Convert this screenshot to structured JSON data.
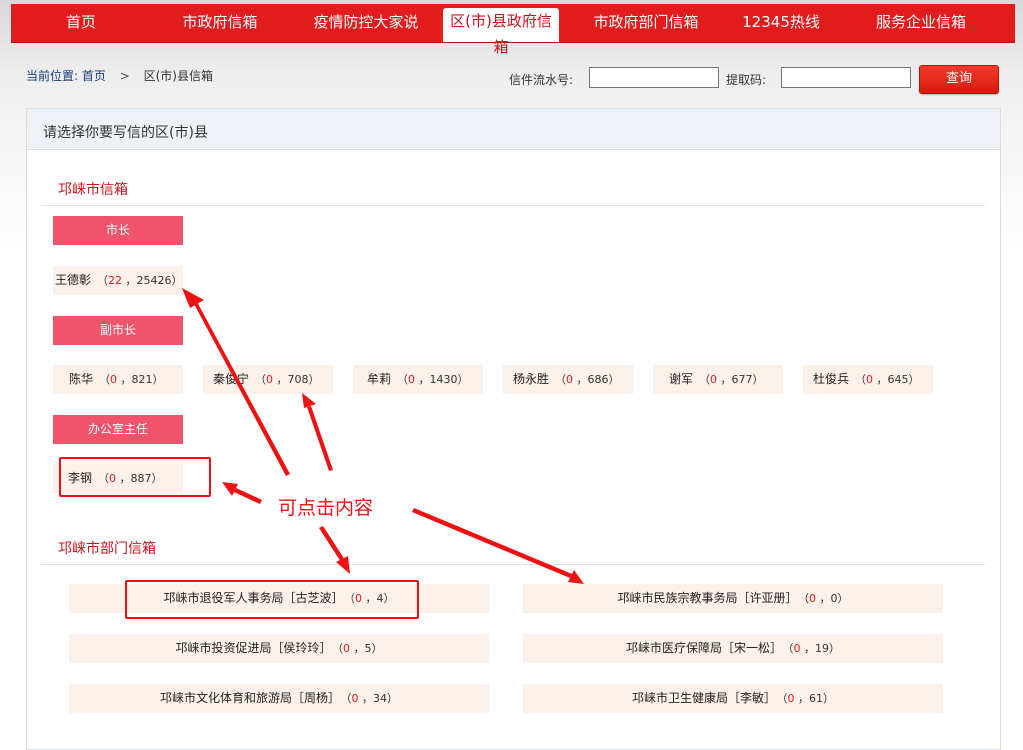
{
  "nav": {
    "items": [
      {
        "label": "首页"
      },
      {
        "label": "市政府信箱"
      },
      {
        "label": "疫情防控大家说"
      },
      {
        "label": "区(市)县政府信箱"
      },
      {
        "label": "市政府部门信箱"
      },
      {
        "label": "12345热线"
      },
      {
        "label": "服务企业信箱"
      }
    ],
    "active_index": 3
  },
  "breadcrumb": {
    "label": "当前位置:",
    "home": "首页",
    "separator": ">",
    "current": "区(市)县信箱"
  },
  "query": {
    "serial_label": "信件流水号:",
    "serial_value": "",
    "code_label": "提取码:",
    "code_value": "",
    "button_label": "查询"
  },
  "panel": {
    "title": "请选择你要写信的区(市)县",
    "city_section": {
      "title": "邛崃市信箱",
      "groups": [
        {
          "role": "市长",
          "people": [
            {
              "name": "王德彰",
              "count": "22",
              "total": "25426"
            }
          ]
        },
        {
          "role": "副市长",
          "people": [
            {
              "name": "陈华",
              "count": "0",
              "total": "821"
            },
            {
              "name": "秦俊宁",
              "count": "0",
              "total": "708"
            },
            {
              "name": "牟莉",
              "count": "0",
              "total": "1430"
            },
            {
              "name": "杨永胜",
              "count": "0",
              "total": "686"
            },
            {
              "name": "谢军",
              "count": "0",
              "total": "677"
            },
            {
              "name": "杜俊兵",
              "count": "0",
              "total": "645"
            }
          ]
        },
        {
          "role": "办公室主任",
          "people": [
            {
              "name": "李钢",
              "count": "0",
              "total": "887"
            }
          ]
        }
      ]
    },
    "dept_section": {
      "title": "邛崃市部门信箱",
      "items": [
        {
          "name": "邛崃市退役军人事务局［古芝波］",
          "count": "0",
          "total": "4"
        },
        {
          "name": "邛崃市民族宗教事务局［许亚册］",
          "count": "0",
          "total": "0"
        },
        {
          "name": "邛崃市投资促进局［侯玲玲］",
          "count": "0",
          "total": "5"
        },
        {
          "name": "邛崃市医疗保障局［宋一松］",
          "count": "0",
          "total": "19"
        },
        {
          "name": "邛崃市文化体育和旅游局［周杨］",
          "count": "0",
          "total": "34"
        },
        {
          "name": "邛崃市卫生健康局［李敏］",
          "count": "0",
          "total": "61"
        }
      ]
    }
  },
  "annotation": {
    "text": "可点击内容",
    "color": "#ee1111"
  },
  "colors": {
    "nav_red": "#e21c1c",
    "role_pink": "#f0546a",
    "item_bg": "#fbf0ea",
    "section_red": "#c8141d"
  }
}
